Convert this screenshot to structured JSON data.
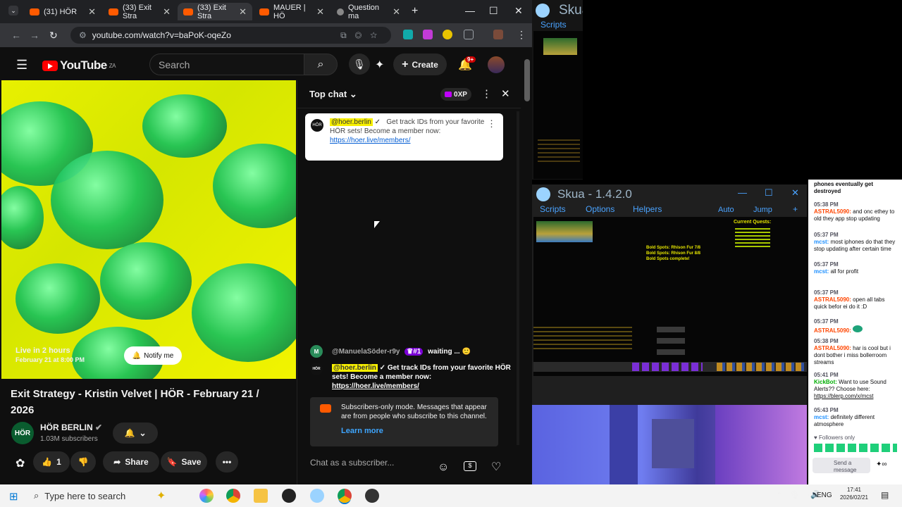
{
  "browser": {
    "tabs": [
      {
        "label": "(31) HÖR",
        "active": false
      },
      {
        "label": "(33) Exit Stra",
        "active": false
      },
      {
        "label": "(33) Exit Stra",
        "active": true
      },
      {
        "label": "MAUER | HÖ",
        "active": false
      },
      {
        "label": "Question ma",
        "active": false
      }
    ],
    "url": "youtube.com/watch?v=baPoK-oqeZo"
  },
  "youtube": {
    "logo": "YouTube",
    "region": "ZA",
    "search_placeholder": "Search",
    "create_label": "Create",
    "notif_count": "9+",
    "live_label": "Live in 2 hours",
    "live_date": "February 21 at 8:00 PM",
    "notify_label": "Notify me",
    "video_title": "Exit Strategy - Kristin Velvet | HÖR - February 21 / 2026",
    "channel_name": "HÖR BERLIN",
    "channel_avatar": "HÖR",
    "subscribers": "1.03M subscribers",
    "like_count": "1",
    "share_label": "Share",
    "save_label": "Save"
  },
  "chat": {
    "title": "Top chat",
    "xp_label": "0XP",
    "pinned_user": "@hoer.berlin",
    "pinned_text": "Get track IDs from your favorite HÖR sets! Become a member now:",
    "pinned_link": "https://hoer.live/members/",
    "msg1_user": "@ManuelaSöder-r9y",
    "msg1_badge": "#1",
    "msg1_text": "waiting ...",
    "msg2_user": "@hoer.berlin",
    "msg2_text": "Get track IDs from your favorite HÖR sets! Become a member now:",
    "msg2_link": "https://hoer.live/members/",
    "submode_text": "Subscribers-only mode. Messages that appear are from people who subscribe to this channel.",
    "learn_more": "Learn more",
    "input_placeholder": "Chat as a subscriber..."
  },
  "skua_top": {
    "title": "Skua",
    "menu": "Scripts"
  },
  "skua": {
    "title": "Skua - 1.4.2.0",
    "menu": [
      "Scripts",
      "Options",
      "Helpers"
    ],
    "right_menu": [
      "Auto",
      "Jump",
      "+"
    ],
    "game_text1": "Bold Spots: Rhison Fur 7/8",
    "game_text2": "Bold Spots: Rhison Fur 8/8",
    "game_text3": "Bold Spots complete!",
    "quest_title": "Current Quests:"
  },
  "twitch": {
    "top_text": "phones eventually get destroyed",
    "messages": [
      {
        "time": "05:38 PM",
        "user": "ASTRAL5090:",
        "text": "and onc ethey to old they app stop updating",
        "color": "#ff4500"
      },
      {
        "time": "05:37 PM",
        "user": "mcst:",
        "text": "most iphones do that they stop updating after certain time",
        "color": "#1e90ff"
      },
      {
        "time": "05:37 PM",
        "user": "mcst:",
        "text": "all for profit",
        "color": "#1e90ff"
      },
      {
        "time": "05:37 PM",
        "user": "ASTRAL5090:",
        "text": "open all tabs quick befor ei do it :D",
        "color": "#ff4500"
      },
      {
        "time": "05:37 PM",
        "user": "ASTRAL5090:",
        "text": "",
        "color": "#ff4500"
      },
      {
        "time": "05:38 PM",
        "user": "ASTRAL5090:",
        "text": "har is cool but i dont bother i miss bollerroom streams",
        "color": "#ff4500"
      },
      {
        "time": "05:41 PM",
        "user": "KickBot:",
        "text": "Want to use Sound Alerts?? Choose here:",
        "color": "#00ad03"
      },
      {
        "time": "05:43 PM",
        "user": "mcst:",
        "text": "definitely different atmosphere",
        "color": "#1e90ff"
      }
    ],
    "kickbot_link": "https://blerp.com/x/mcst",
    "followers_only": "Followers only",
    "send_placeholder": "Send a message"
  },
  "taskbar": {
    "search_placeholder": "Type here to search",
    "lang": "ENG",
    "time": "17:41",
    "date": "2026/02/21"
  }
}
